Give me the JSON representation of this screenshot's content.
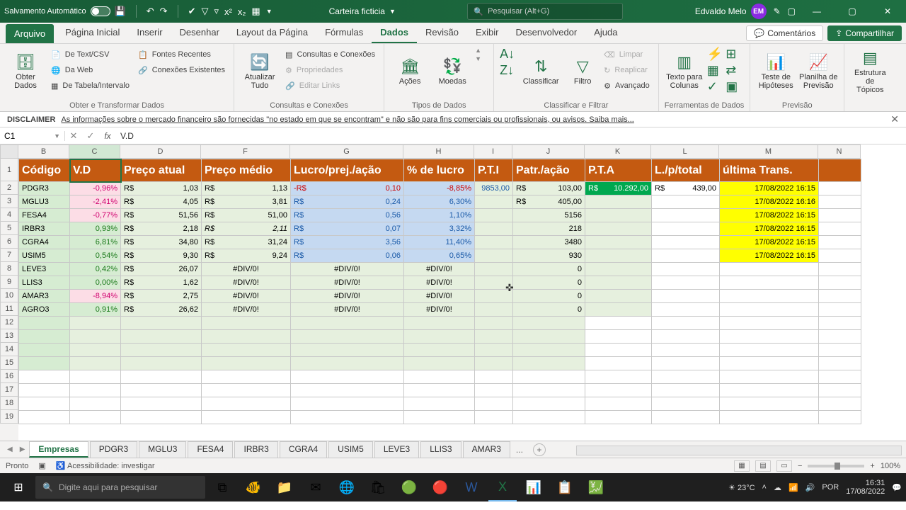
{
  "titlebar": {
    "autosave": "Salvamento Automático",
    "filename": "Carteira ficticia",
    "search_placeholder": "Pesquisar (Alt+G)",
    "user": "Edvaldo Melo",
    "initials": "EM"
  },
  "tabs": {
    "file": "Arquivo",
    "items": [
      "Página Inicial",
      "Inserir",
      "Desenhar",
      "Layout da Página",
      "Fórmulas",
      "Dados",
      "Revisão",
      "Exibir",
      "Desenvolvedor",
      "Ajuda"
    ],
    "active": "Dados",
    "comments": "Comentários",
    "share": "Compartilhar"
  },
  "ribbon": {
    "g1": {
      "big": "Obter\nDados",
      "i1": "De Text/CSV",
      "i2": "Da Web",
      "i3": "De Tabela/Intervalo",
      "i4": "Fontes Recentes",
      "i5": "Conexões Existentes",
      "label": "Obter e Transformar Dados"
    },
    "g2": {
      "big": "Atualizar\nTudo",
      "i1": "Consultas e Conexões",
      "i2": "Propriedades",
      "i3": "Editar Links",
      "label": "Consultas e Conexões"
    },
    "g3": {
      "b1": "Ações",
      "b2": "Moedas",
      "label": "Tipos de Dados"
    },
    "g4": {
      "sort": "Classificar",
      "filter": "Filtro",
      "c1": "Limpar",
      "c2": "Reaplicar",
      "c3": "Avançado",
      "label": "Classificar e Filtrar"
    },
    "g5": {
      "b1": "Texto para\nColunas",
      "label": "Ferramentas de Dados"
    },
    "g6": {
      "b1": "Teste de\nHipóteses",
      "b2": "Planilha de\nPrevisão",
      "label": "Previsão"
    },
    "g7": {
      "b1": "Estrutura de\nTópicos"
    }
  },
  "disclaimer": {
    "label": "DISCLAIMER",
    "text": "As informações sobre o mercado financeiro são fornecidas \"no estado em que se encontram\" e não são para fins comerciais ou profissionais, ou avisos. Saiba mais..."
  },
  "fbar": {
    "name": "C1",
    "formula": "V.D"
  },
  "columns": [
    {
      "letter": "B",
      "w": 72
    },
    {
      "letter": "C",
      "w": 72
    },
    {
      "letter": "D",
      "w": 114
    },
    {
      "letter": "F",
      "w": 126
    },
    {
      "letter": "G",
      "w": 160
    },
    {
      "letter": "H",
      "w": 100
    },
    {
      "letter": "I",
      "w": 54
    },
    {
      "letter": "J",
      "w": 102
    },
    {
      "letter": "K",
      "w": 94
    },
    {
      "letter": "L",
      "w": 96
    },
    {
      "letter": "M",
      "w": 140
    },
    {
      "letter": "N",
      "w": 60
    }
  ],
  "headers": [
    "Código",
    "V.D",
    "Preço atual",
    "Preço médio",
    "Lucro/prej./ação",
    "% de lucro",
    "P.T.I",
    "Patr./ação",
    "P.T.A",
    "L./p/total",
    "última Trans."
  ],
  "rows": [
    {
      "cod": "PDGR3",
      "vd": "-0,96%",
      "vdcls": "pos-pink",
      "pa": "R$            1,03",
      "pm": "R$            1,13",
      "lp": "-R$            0,10",
      "lpcls": "lp-neg",
      "pl": "-8,85%",
      "plcls": "lp-neg",
      "pti": "9853,00",
      "patr": "R$          103,00",
      "pta": "R$  10.292,00",
      "lpt": "R$       439,00",
      "trans": "17/08/2022 16:15"
    },
    {
      "cod": "MGLU3",
      "vd": "-2,41%",
      "vdcls": "pos-pink",
      "pa": "R$            4,05",
      "pm": "R$            3,81",
      "lp": " R$            0,24",
      "lpcls": "lp-pos",
      "pl": "6,30%",
      "plcls": "lp-pos",
      "pti": "",
      "patr": "R$          405,00",
      "pta": "",
      "lpt": "",
      "trans": "17/08/2022 16:16"
    },
    {
      "cod": "FESA4",
      "vd": "-0,77%",
      "vdcls": "pos-pink",
      "pa": "R$          51,56",
      "pm": "R$          51,00",
      "lp": " R$            0,56",
      "lpcls": "lp-pos",
      "pl": "1,10%",
      "plcls": "lp-pos",
      "pti": "",
      "patr": "5156",
      "pta": "",
      "lpt": "",
      "trans": "17/08/2022 16:15"
    },
    {
      "cod": "IRBR3",
      "vd": "0,93%",
      "vdcls": "pos-green",
      "pa": "R$            2,18",
      "pm": "R$            2,11",
      "lp": " R$            0,07",
      "lpcls": "lp-pos",
      "pl": "3,32%",
      "plcls": "lp-pos",
      "pti": "",
      "patr": "218",
      "pta": "",
      "lpt": "",
      "trans": "17/08/2022 16:15",
      "pmItalic": true
    },
    {
      "cod": "CGRA4",
      "vd": "6,81%",
      "vdcls": "pos-green",
      "pa": "R$          34,80",
      "pm": "R$          31,24",
      "lp": " R$            3,56",
      "lpcls": "lp-pos",
      "pl": "11,40%",
      "plcls": "lp-pos",
      "pti": "",
      "patr": "3480",
      "pta": "",
      "lpt": "",
      "trans": "17/08/2022 16:15"
    },
    {
      "cod": "USIM5",
      "vd": "0,54%",
      "vdcls": "pos-green",
      "pa": "R$            9,30",
      "pm": "R$            9,24",
      "lp": " R$            0,06",
      "lpcls": "lp-pos",
      "pl": "0,65%",
      "plcls": "lp-pos",
      "pti": "",
      "patr": "930",
      "pta": "",
      "lpt": "",
      "trans": "17/08/2022 16:15"
    },
    {
      "cod": "LEVE3",
      "vd": "0,42%",
      "vdcls": "pos-green",
      "pa": "R$          26,07",
      "pm": "#DIV/0!",
      "lp": "#DIV/0!",
      "lpcls": "div0",
      "pl": "#DIV/0!",
      "plcls": "div0",
      "pti": "",
      "patr": "0",
      "pta": "",
      "lpt": "",
      "trans": "",
      "div": true
    },
    {
      "cod": "LLIS3",
      "vd": "0,00%",
      "vdcls": "pos-green",
      "pa": "R$            1,62",
      "pm": "#DIV/0!",
      "lp": "#DIV/0!",
      "lpcls": "div0",
      "pl": "#DIV/0!",
      "plcls": "div0",
      "pti": "",
      "patr": "0",
      "pta": "",
      "lpt": "",
      "trans": "",
      "div": true
    },
    {
      "cod": "AMAR3",
      "vd": "-8,94%",
      "vdcls": "pos-pink",
      "pa": "R$            2,75",
      "pm": "#DIV/0!",
      "lp": "#DIV/0!",
      "lpcls": "div0",
      "pl": "#DIV/0!",
      "plcls": "div0",
      "pti": "",
      "patr": "0",
      "pta": "",
      "lpt": "",
      "trans": "",
      "div": true
    },
    {
      "cod": "AGRO3",
      "vd": "0,91%",
      "vdcls": "pos-green",
      "pa": "R$          26,62",
      "pm": "#DIV/0!",
      "lp": "#DIV/0!",
      "lpcls": "div0",
      "pl": "#DIV/0!",
      "plcls": "div0",
      "pti": "",
      "patr": "0",
      "pta": "",
      "lpt": "",
      "trans": "",
      "div": true
    }
  ],
  "sheets": {
    "active": "Empresas",
    "items": [
      "Empresas",
      "PDGR3",
      "MGLU3",
      "FESA4",
      "IRBR3",
      "CGRA4",
      "USIM5",
      "LEVE3",
      "LLIS3",
      "AMAR3"
    ],
    "more": "..."
  },
  "status": {
    "ready": "Pronto",
    "access": "Acessibilidade: investigar",
    "zoom": "100%"
  },
  "taskbar": {
    "search": "Digite aqui para pesquisar",
    "weather": "23°C",
    "time": "16:31",
    "date": "17/08/2022"
  }
}
